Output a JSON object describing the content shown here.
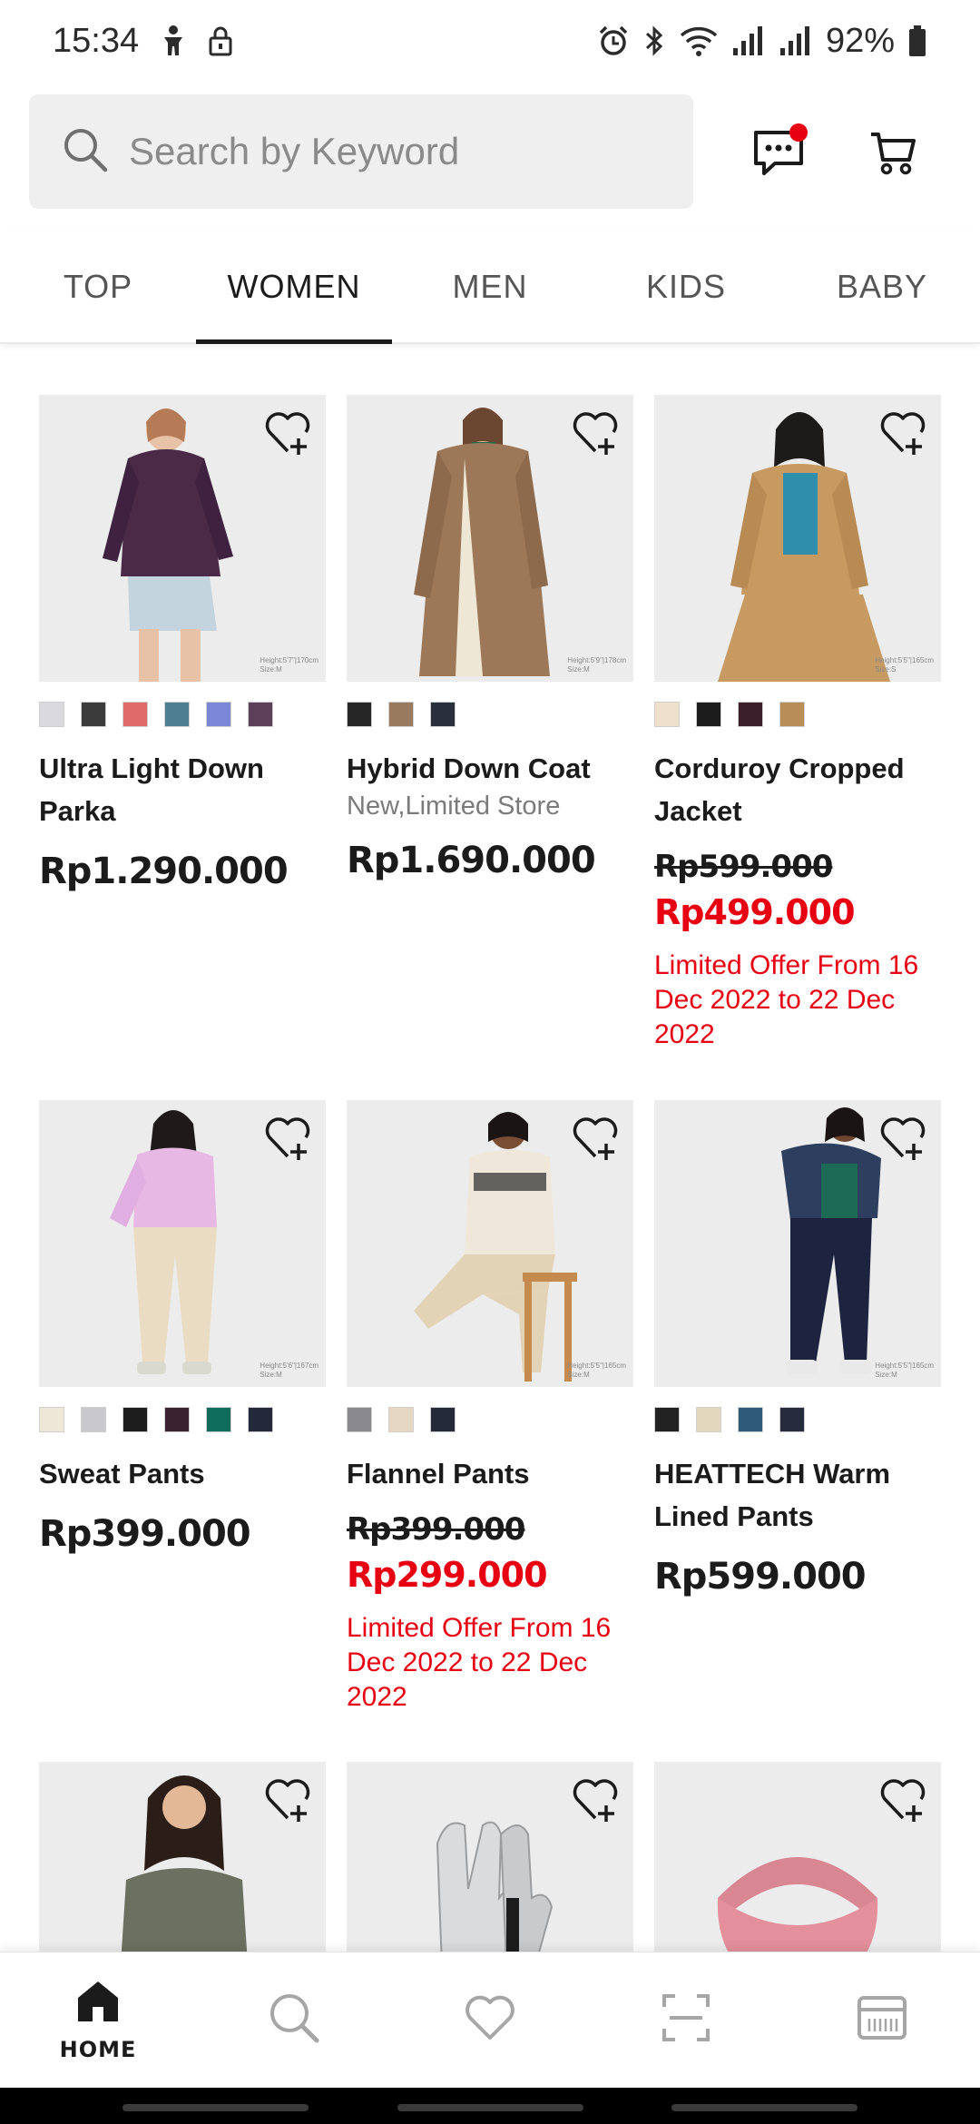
{
  "status": {
    "time": "15:34",
    "battery": "92%"
  },
  "search": {
    "placeholder": "Search by Keyword"
  },
  "tabs": [
    {
      "label": "TOP"
    },
    {
      "label": "WOMEN"
    },
    {
      "label": "MEN"
    },
    {
      "label": "KIDS"
    },
    {
      "label": "BABY"
    }
  ],
  "active_tab": "WOMEN",
  "products": [
    {
      "name": "Ultra Light Down Parka",
      "tag": "",
      "price": "Rp1.290.000",
      "old_price": "",
      "sale_price": "",
      "offer": "",
      "swatches": [
        "#d9d9de",
        "#3b3b3b",
        "#e06a6a",
        "#4e7f91",
        "#7b86d6",
        "#5c3f58"
      ]
    },
    {
      "name": "Hybrid Down Coat",
      "tag": "New,Limited Store",
      "price": "Rp1.690.000",
      "old_price": "",
      "sale_price": "",
      "offer": "",
      "swatches": [
        "#262626",
        "#9a7a5e",
        "#2a2f3e"
      ]
    },
    {
      "name": "Corduroy Cropped Jacket",
      "tag": "",
      "price": "",
      "old_price": "Rp599.000",
      "sale_price": "Rp499.000",
      "offer": "Limited Offer From 16 Dec 2022 to 22 Dec 2022",
      "swatches": [
        "#efe0cc",
        "#1c1c1c",
        "#3b1f2b",
        "#b88d58"
      ]
    },
    {
      "name": "Sweat Pants",
      "tag": "",
      "price": "Rp399.000",
      "old_price": "",
      "sale_price": "",
      "offer": "",
      "swatches": [
        "#eee7d8",
        "#c8c8cc",
        "#1d1d1d",
        "#3a2230",
        "#0e6e5b",
        "#23283a"
      ]
    },
    {
      "name": "Flannel Pants",
      "tag": "",
      "price": "",
      "old_price": "Rp399.000",
      "sale_price": "Rp299.000",
      "offer": "Limited Offer From 16 Dec 2022 to 22 Dec 2022",
      "swatches": [
        "#8a8a8e",
        "#e6d7c3",
        "#252a3a"
      ]
    },
    {
      "name": "HEATTECH Warm Lined Pants",
      "tag": "",
      "price": "Rp599.000",
      "old_price": "",
      "sale_price": "",
      "offer": "",
      "swatches": [
        "#222222",
        "#e3d8bd",
        "#2f5a78",
        "#262b3d"
      ]
    }
  ],
  "bottom_nav": [
    {
      "label": "HOME",
      "icon": "home-icon"
    },
    {
      "label": "",
      "icon": "search-icon"
    },
    {
      "label": "",
      "icon": "heart-icon"
    },
    {
      "label": "",
      "icon": "scan-icon"
    },
    {
      "label": "",
      "icon": "membership-card-icon"
    }
  ],
  "colors": {
    "accent_red": "#e60012",
    "text": "#1b1b1b",
    "muted": "#7b7b7b"
  }
}
